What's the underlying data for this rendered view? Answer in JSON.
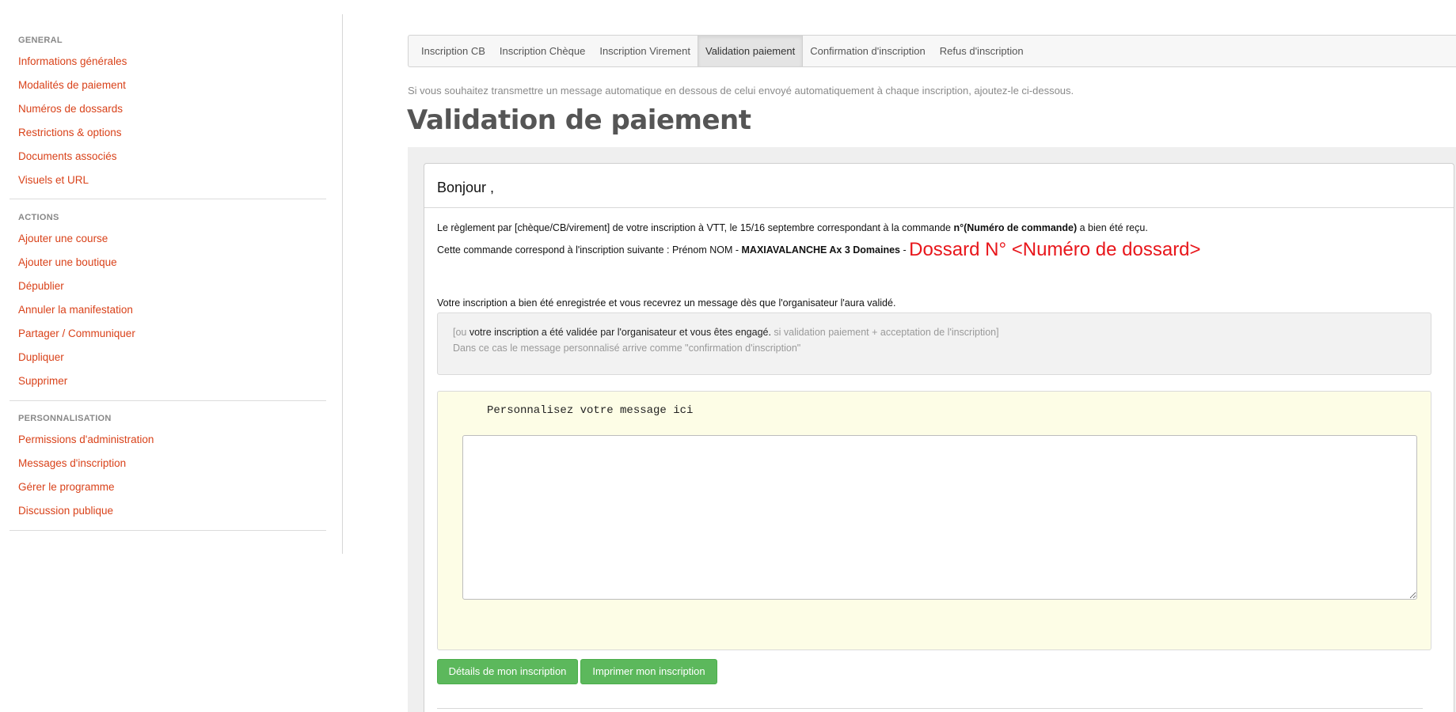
{
  "sidebar": {
    "sections": [
      {
        "heading": "GENERAL",
        "items": [
          "Informations générales",
          "Modalités de paiement",
          "Numéros de dossards",
          "Restrictions & options",
          "Documents associés",
          "Visuels et URL"
        ]
      },
      {
        "heading": "ACTIONS",
        "items": [
          "Ajouter une course",
          "Ajouter une boutique",
          "Dépublier",
          "Annuler la manifestation",
          "Partager / Communiquer",
          "Dupliquer",
          "Supprimer"
        ]
      },
      {
        "heading": "PERSONNALISATION",
        "items": [
          "Permissions d'administration",
          "Messages d'inscription",
          "Gérer le programme",
          "Discussion publique"
        ]
      }
    ]
  },
  "tabs": [
    {
      "label": "Inscription CB",
      "active": false
    },
    {
      "label": "Inscription Chèque",
      "active": false
    },
    {
      "label": "Inscription Virement",
      "active": false
    },
    {
      "label": "Validation paiement",
      "active": true
    },
    {
      "label": "Confirmation d'inscription",
      "active": false
    },
    {
      "label": "Refus d'inscription",
      "active": false
    }
  ],
  "intro": "Si vous souhaitez transmettre un message automatique en dessous de celui envoyé automatiquement à chaque inscription, ajoutez-le ci-dessous.",
  "page_title": "Validation de paiement",
  "email": {
    "greeting": "Bonjour ,",
    "line1_a": "Le règlement par [chèque/CB/virement] de votre inscription à VTT, le 15/16 septembre correspondant à la commande ",
    "line1_b": "n°(Numéro de commande)",
    "line1_c": " a bien été reçu.",
    "line2_a": "Cette commande correspond à l'inscription suivante : Prénom NOM - ",
    "line2_b": "MAXIAVALANCHE Ax 3 Domaines",
    "line2_c": " - ",
    "dossard": "Dossard N° <Numéro de dossard>",
    "line3": "Votre inscription a bien été enregistrée et vous recevrez un message dès que l'organisateur l'aura validé.",
    "note_a": "[ou ",
    "note_b": "votre inscription a été validée par l'organisateur et vous êtes engagé.",
    "note_c": " si validation paiement + acceptation de l'inscription]",
    "note_line2": "Dans ce cas le message personnalisé arrive comme \"confirmation d'inscription\"",
    "custom_label": "Personnalisez votre message ici",
    "custom_value": ""
  },
  "buttons": {
    "details": "Détails de mon inscription",
    "print": "Imprimer mon inscription"
  },
  "colors": {
    "link": "#d9421a",
    "button": "#5cb85c",
    "dossard": "#e8161b",
    "custom_bg": "#fdfde6"
  }
}
